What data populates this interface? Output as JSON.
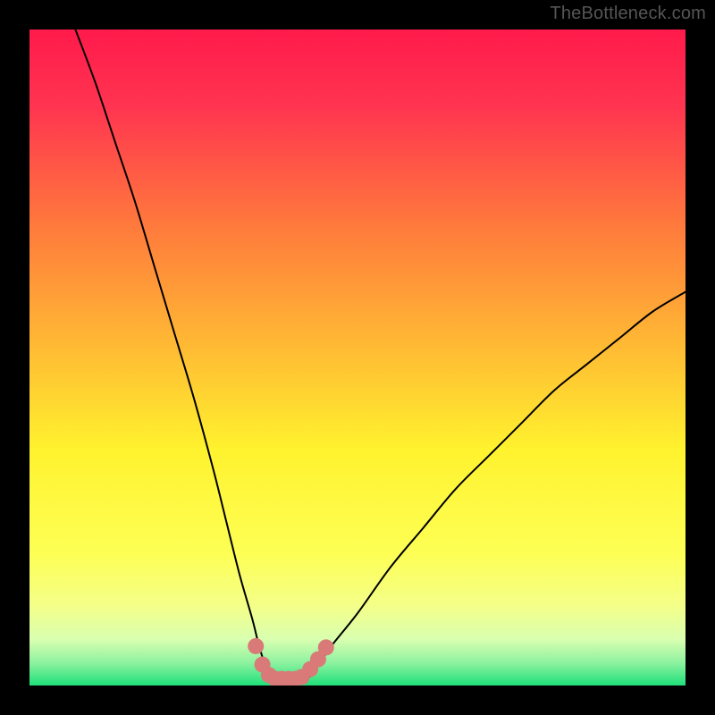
{
  "watermark": "TheBottleneck.com",
  "chart_data": {
    "type": "line",
    "title": "",
    "xlabel": "",
    "ylabel": "",
    "xlim": [
      0,
      100
    ],
    "ylim": [
      0,
      100
    ],
    "grid": false,
    "legend": false,
    "background_gradient": {
      "top_color": "#ff1a4b",
      "mid_top_color": "#ff8a3a",
      "mid_color": "#fff22e",
      "mid_bottom_color": "#f8ff70",
      "bottom_color": "#1fe07a"
    },
    "series": [
      {
        "name": "bottleneck-curve",
        "color": "#000000",
        "x": [
          7,
          10,
          13,
          16,
          19,
          22,
          25,
          28,
          30,
          32,
          34,
          35,
          36,
          37,
          39,
          41,
          43,
          44,
          46,
          50,
          55,
          60,
          65,
          70,
          75,
          80,
          85,
          90,
          95,
          100
        ],
        "y": [
          100,
          92,
          83,
          74,
          64,
          54,
          44,
          33,
          25,
          17,
          10,
          6,
          3,
          1.5,
          1,
          1,
          1.5,
          3,
          6,
          11,
          18,
          24,
          30,
          35,
          40,
          45,
          49,
          53,
          57,
          60
        ]
      }
    ],
    "markers": {
      "name": "highlight-dots",
      "color": "#d97a78",
      "radius": 9,
      "x": [
        34.5,
        35.5,
        36.5,
        37.5,
        38.5,
        39.5,
        40.5,
        41.5,
        42.8,
        44.0,
        45.2
      ],
      "y": [
        6.0,
        3.2,
        1.6,
        1.0,
        1.0,
        1.0,
        1.0,
        1.3,
        2.5,
        4.0,
        5.8
      ]
    }
  }
}
